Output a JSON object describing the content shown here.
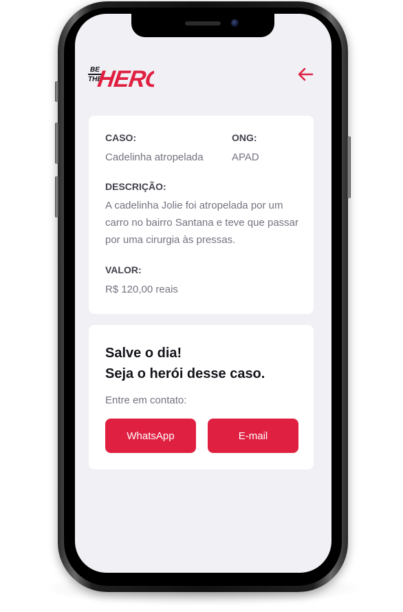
{
  "brand": {
    "logo_text": "BE THE HERO",
    "accent_color": "#e02041"
  },
  "header": {
    "back_icon": "arrow-left-icon"
  },
  "incident": {
    "case_label": "CASO:",
    "case_value": "Cadelinha atropelada",
    "ong_label": "ONG:",
    "ong_value": "APAD",
    "description_label": "DESCRIÇÃO:",
    "description_value": "A cadelinha Jolie foi atropelada por um carro no bairro Santana e teve que passar por uma cirurgia às pressas.",
    "value_label": "VALOR:",
    "value_value": "R$ 120,00 reais"
  },
  "contact": {
    "title_line1": "Salve o dia!",
    "title_line2": "Seja o herói desse caso.",
    "subtitle": "Entre em contato:",
    "whatsapp_label": "WhatsApp",
    "email_label": "E-mail"
  }
}
